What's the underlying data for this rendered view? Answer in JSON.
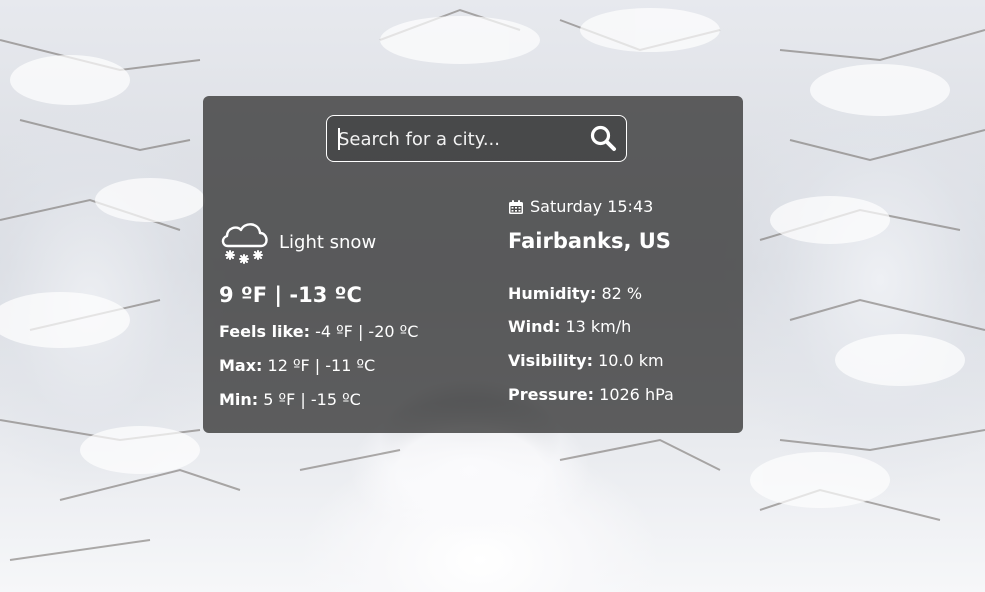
{
  "search": {
    "placeholder": "Search for a city...",
    "icon": "search-icon"
  },
  "current": {
    "condition": "Light snow",
    "condition_icon": "snow-cloud-icon",
    "temperature": "9 ºF | -13 ºC",
    "feels_like_label": "Feels like:",
    "feels_like_value": " -4 ºF | -20 ºC",
    "max_label": "Max:",
    "max_value": " 12 ºF | -11 ºC",
    "min_label": "Min:",
    "min_value": " 5 ºF | -15 ºC"
  },
  "location": {
    "date_icon": "calendar-icon",
    "datetime": "Saturday 15:43",
    "city": "Fairbanks, US"
  },
  "details": {
    "humidity_label": "Humidity:",
    "humidity_value": " 82 %",
    "wind_label": "Wind:",
    "wind_value": " 13 km/h",
    "visibility_label": "Visibility:",
    "visibility_value": " 10.0 km",
    "pressure_label": "Pressure:",
    "pressure_value": " 1026 hPa"
  },
  "colors": {
    "card_bg": "#343434",
    "text": "#ffffff"
  }
}
